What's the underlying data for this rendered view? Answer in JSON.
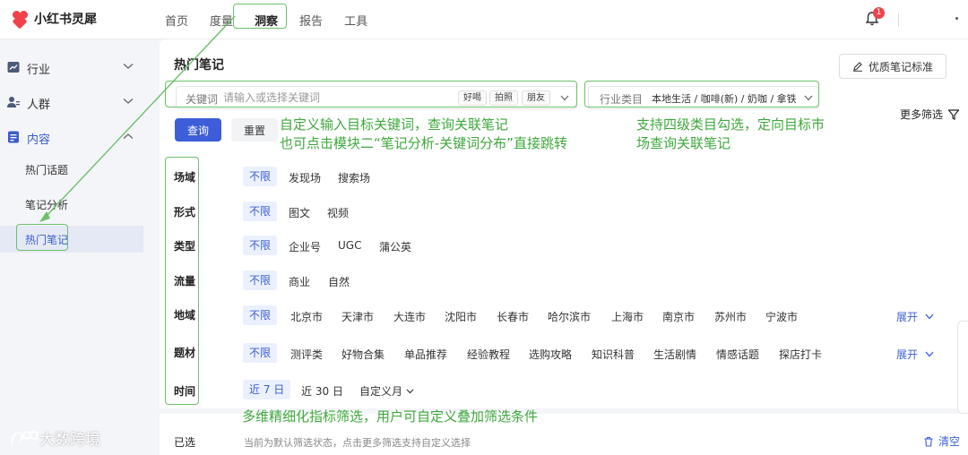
{
  "app": {
    "logo_text": "小红书灵犀"
  },
  "nav": {
    "items": [
      "首页",
      "度量",
      "洞察",
      "报告",
      "工具"
    ],
    "active": "洞察"
  },
  "notifications": {
    "count": "1"
  },
  "sidebar": {
    "groups": [
      {
        "label": "行业",
        "icon": "trend-chart-icon"
      },
      {
        "label": "人群",
        "icon": "users-icon"
      },
      {
        "label": "内容",
        "icon": "document-icon"
      }
    ],
    "sub_items": [
      "热门话题",
      "笔记分析",
      "热门笔记"
    ],
    "active_sub": "热门笔记"
  },
  "page": {
    "title": "热门笔记",
    "standard_button": "优质笔记标准"
  },
  "search": {
    "keyword_label": "关键词",
    "keyword_placeholder": "请输入或选择关键词",
    "keyword_tags": [
      "好喝",
      "拍照",
      "朋友"
    ],
    "category_label": "行业类目",
    "category_value": "本地生活 / 咖啡(新) / 奶咖 / 拿铁",
    "query_button": "查询",
    "reset_button": "重置",
    "more_filter": "更多筛选"
  },
  "filters": {
    "unlimited": "不限",
    "rows": [
      {
        "label": "场域",
        "options": [
          "发现场",
          "搜索场"
        ]
      },
      {
        "label": "形式",
        "options": [
          "图文",
          "视频"
        ]
      },
      {
        "label": "类型",
        "options": [
          "企业号",
          "UGC",
          "蒲公英"
        ]
      },
      {
        "label": "流量",
        "options": [
          "商业",
          "自然"
        ]
      },
      {
        "label": "地域",
        "options": [
          "北京市",
          "天津市",
          "大连市",
          "沈阳市",
          "长春市",
          "哈尔滨市",
          "上海市",
          "南京市",
          "苏州市",
          "宁波市"
        ],
        "expand": "展开"
      },
      {
        "label": "题材",
        "options": [
          "测评类",
          "好物合集",
          "单品推荐",
          "经验教程",
          "选购攻略",
          "知识科普",
          "生活剧情",
          "情感话题",
          "探店打卡"
        ],
        "expand": "展开"
      },
      {
        "label": "时间",
        "active": "近 7 日",
        "options": [
          "近 30 日",
          "自定义月"
        ]
      }
    ]
  },
  "selected": {
    "label": "已选",
    "hint": "当前为默认筛选状态，点击更多筛选支持自定义选择",
    "clear": "清空"
  },
  "annotations": {
    "keyword_note_1": "自定义输入目标关键词，查询关联笔记",
    "keyword_note_2": "也可点击模块二“笔记分析-关键词分布”直接跳转",
    "category_note_1": "支持四级类目勾选，定向目标市",
    "category_note_2": "场查询关联笔记",
    "filter_note": "多维精细化指标筛选，用户可自定义叠加筛选条件"
  },
  "watermark": {
    "text": "大数跨境"
  },
  "colors": {
    "primary": "#3d5ed8",
    "annotation": "#6cc06a",
    "brand": "#f0424a"
  }
}
